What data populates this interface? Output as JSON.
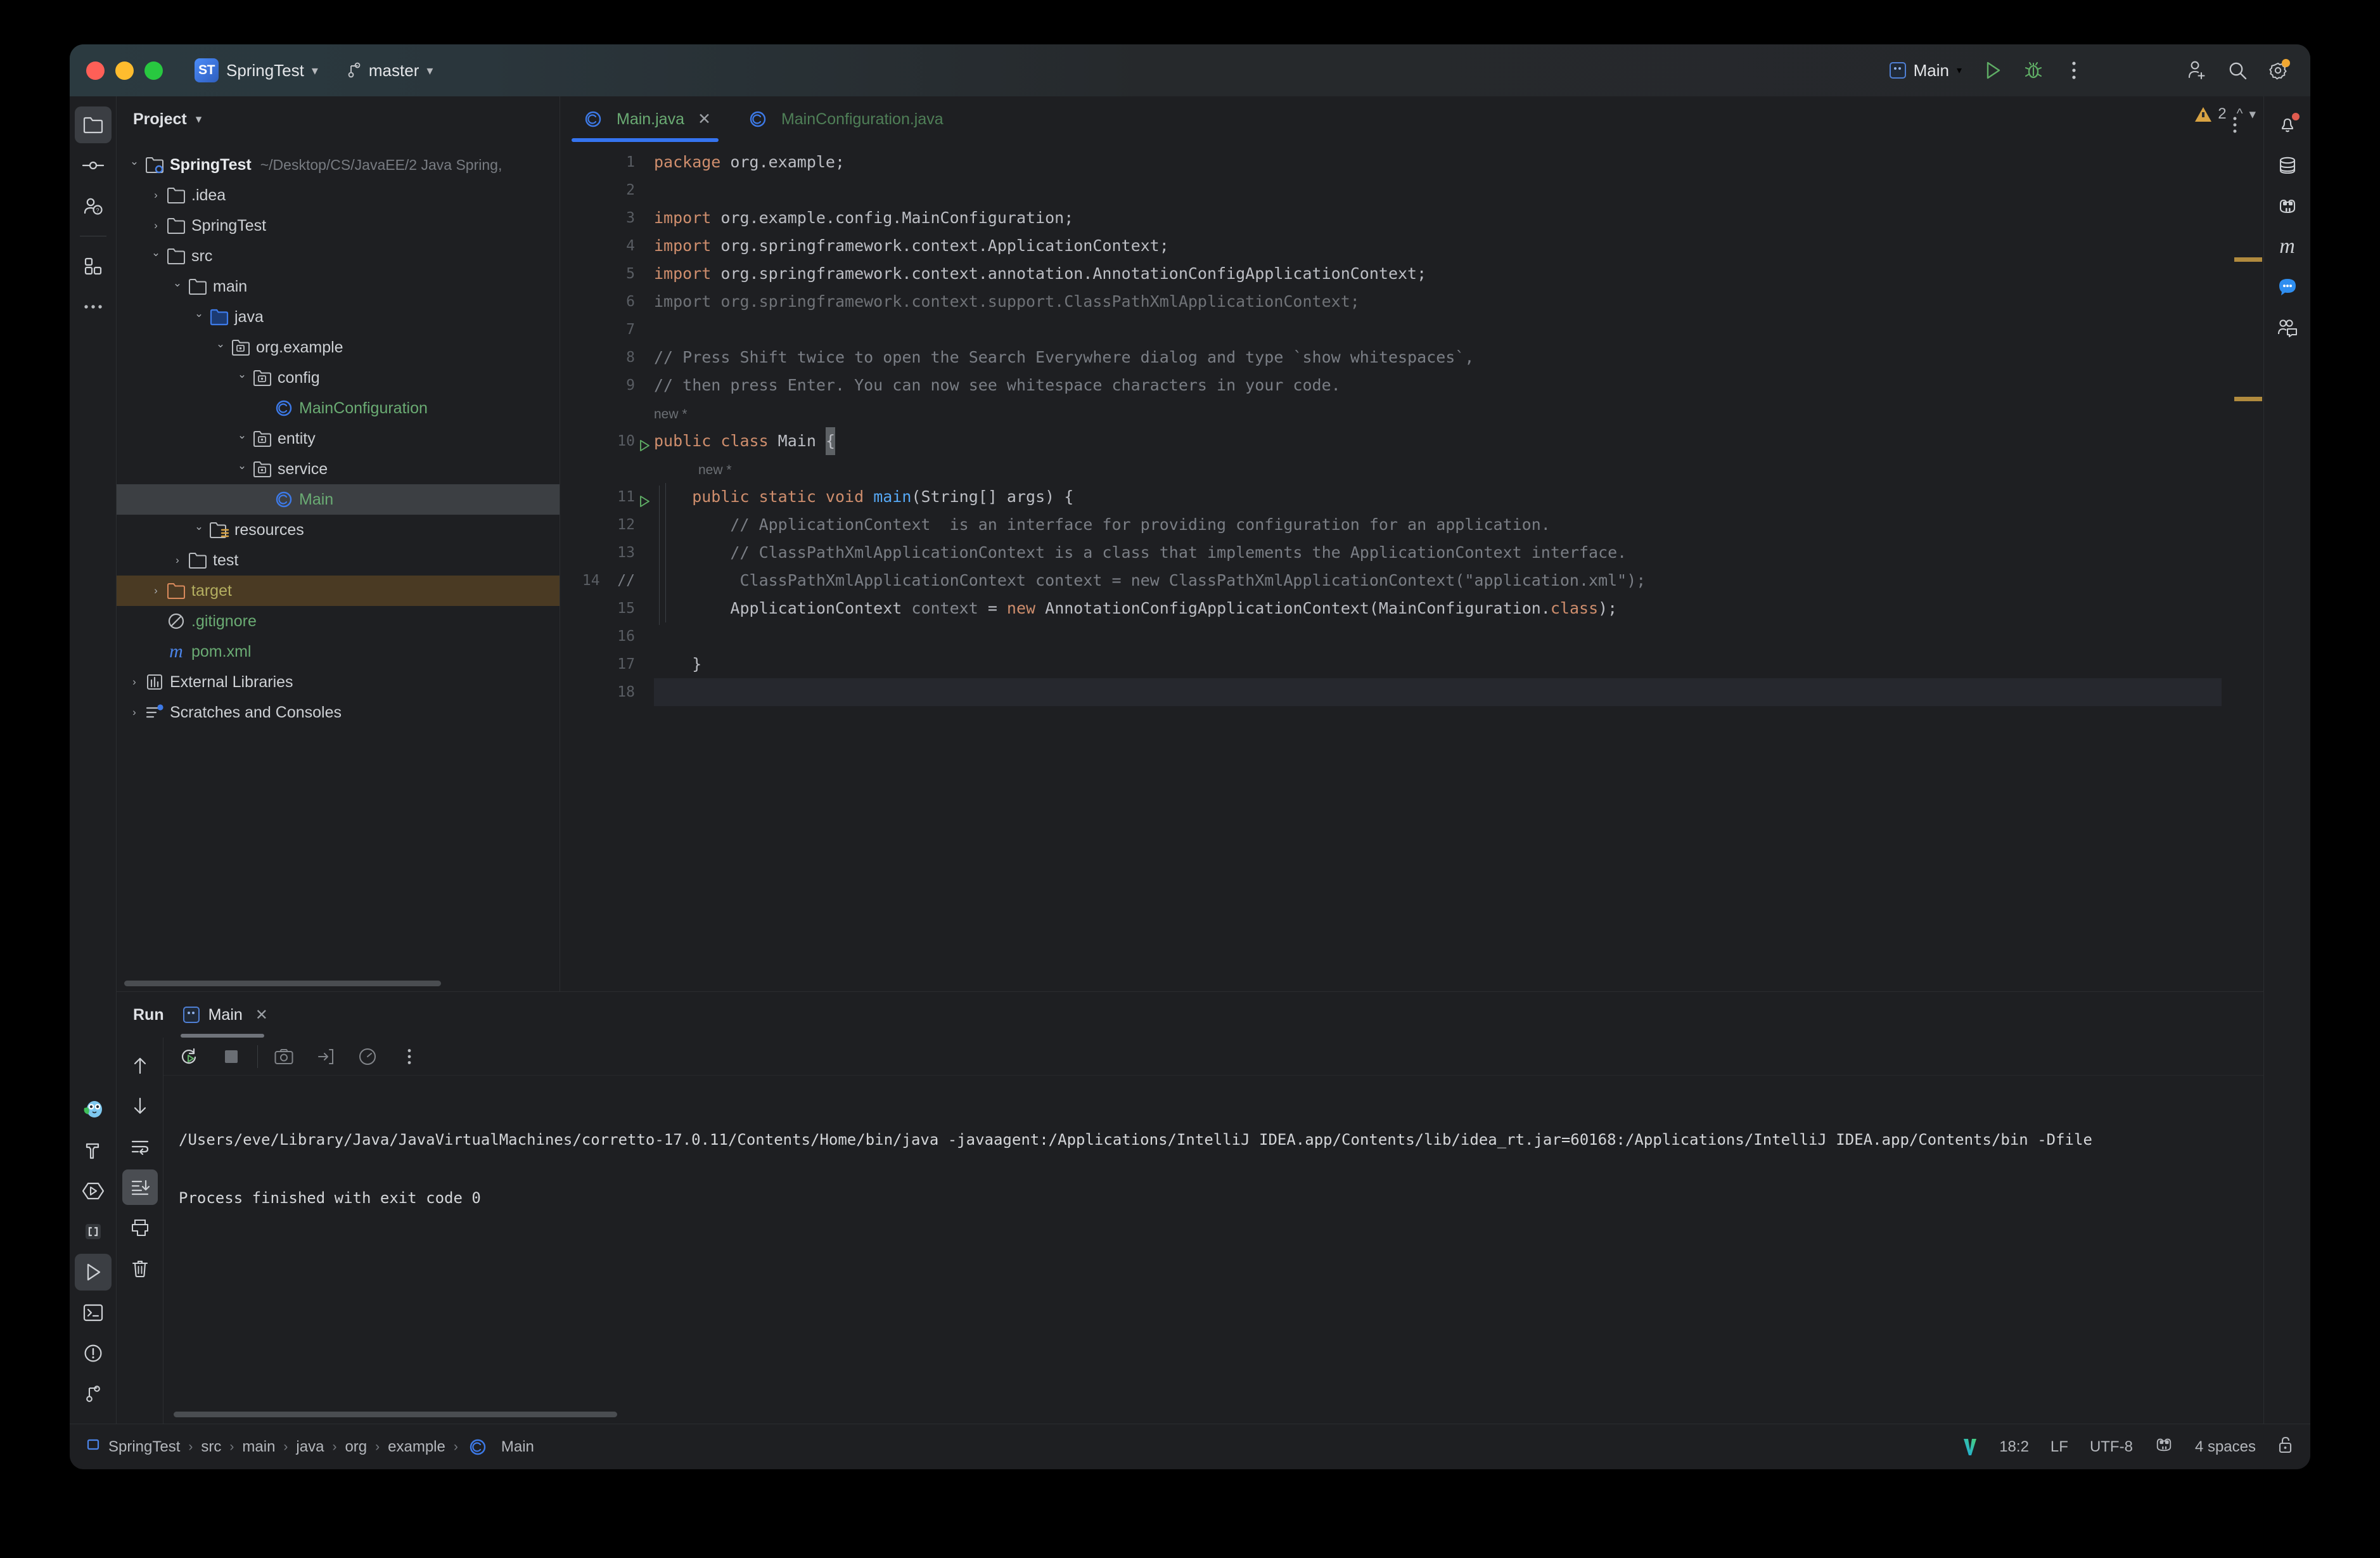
{
  "window": {
    "titlebar": {
      "project_badge": "ST",
      "project_name": "SpringTest",
      "branch": "master",
      "run_config": "Main",
      "icons": [
        "run-icon",
        "debug-icon",
        "more-options-icon",
        "add-user-icon",
        "search-icon",
        "settings-icon"
      ]
    }
  },
  "left_strip": {
    "items": [
      {
        "name": "project-tool-window",
        "icon": "folder-icon",
        "selected": true
      },
      {
        "name": "commit-tool-window",
        "icon": "commit-icon",
        "selected": false
      },
      {
        "name": "pull-requests-tool-window",
        "icon": "user-question-icon",
        "selected": false
      },
      {
        "name": "structure-tool-window",
        "icon": "structure-icon",
        "selected": false
      },
      {
        "name": "more-tool-windows",
        "icon": "ellipsis-icon",
        "selected": false
      }
    ],
    "bottom_items": [
      {
        "name": "plugin-tool-window",
        "icon": "owl-icon",
        "selected": false
      },
      {
        "name": "build-tool-window",
        "icon": "hammer-icon",
        "selected": false
      },
      {
        "name": "run-anything",
        "icon": "run-hex-icon",
        "selected": false
      },
      {
        "name": "brackets-tool-window",
        "icon": "brackets-icon",
        "selected": false
      },
      {
        "name": "run-tool-window",
        "icon": "play-icon",
        "selected": true
      },
      {
        "name": "terminal-tool-window",
        "icon": "terminal-icon",
        "selected": false
      },
      {
        "name": "problems-tool-window",
        "icon": "warning-circle-icon",
        "selected": false
      },
      {
        "name": "git-tool-window",
        "icon": "branch-icon",
        "selected": false
      }
    ]
  },
  "right_strip": {
    "items": [
      {
        "name": "notifications",
        "icon": "bell-icon",
        "badge": true
      },
      {
        "name": "database",
        "icon": "database-icon",
        "badge": false
      },
      {
        "name": "endpoints",
        "icon": "gradle-icon",
        "badge": false
      },
      {
        "name": "maven",
        "icon": "maven-m-icon",
        "badge": false
      },
      {
        "name": "ai-assistant",
        "icon": "ai-chat-icon",
        "badge": false
      },
      {
        "name": "code-with-me",
        "icon": "code-with-me-icon",
        "badge": false
      }
    ]
  },
  "project_panel": {
    "title": "Project",
    "tree": [
      {
        "label": "SpringTest",
        "path": "~/Desktop/CS/JavaEE/2 Java Spring,",
        "indent": 0,
        "arrow": "down",
        "icon": "module-icon",
        "style": "bold"
      },
      {
        "label": ".idea",
        "indent": 1,
        "arrow": "right",
        "icon": "folder-icon",
        "style": "normal"
      },
      {
        "label": "SpringTest",
        "indent": 1,
        "arrow": "right",
        "icon": "folder-icon",
        "style": "normal"
      },
      {
        "label": "src",
        "indent": 1,
        "arrow": "down",
        "icon": "folder-icon",
        "style": "normal"
      },
      {
        "label": "main",
        "indent": 2,
        "arrow": "down",
        "icon": "folder-icon",
        "style": "normal"
      },
      {
        "label": "java",
        "indent": 3,
        "arrow": "down",
        "icon": "source-folder-icon",
        "style": "normal"
      },
      {
        "label": "org.example",
        "indent": 4,
        "arrow": "down",
        "icon": "package-icon",
        "style": "normal"
      },
      {
        "label": "config",
        "indent": 5,
        "arrow": "down",
        "icon": "package-icon",
        "style": "normal"
      },
      {
        "label": "MainConfiguration",
        "indent": 6,
        "arrow": "none",
        "icon": "class-icon",
        "style": "green"
      },
      {
        "label": "entity",
        "indent": 5,
        "arrow": "down",
        "icon": "package-icon",
        "style": "normal"
      },
      {
        "label": "service",
        "indent": 5,
        "arrow": "down",
        "icon": "package-icon",
        "style": "normal"
      },
      {
        "label": "Main",
        "indent": 6,
        "arrow": "none",
        "icon": "class-icon",
        "style": "green",
        "selected": true
      },
      {
        "label": "resources",
        "indent": 3,
        "arrow": "down",
        "icon": "resources-folder-icon",
        "style": "normal"
      },
      {
        "label": "test",
        "indent": 2,
        "arrow": "right",
        "icon": "folder-icon",
        "style": "normal"
      },
      {
        "label": "target",
        "indent": 1,
        "arrow": "right",
        "icon": "excluded-folder-icon",
        "style": "yellow",
        "highlighted": true
      },
      {
        "label": ".gitignore",
        "indent": 1,
        "arrow": "none",
        "icon": "gitignore-icon",
        "style": "green"
      },
      {
        "label": "pom.xml",
        "indent": 1,
        "arrow": "none",
        "icon": "maven-m-icon",
        "style": "green"
      },
      {
        "label": "External Libraries",
        "indent": 0,
        "arrow": "right",
        "icon": "libraries-icon",
        "style": "normal"
      },
      {
        "label": "Scratches and Consoles",
        "indent": 0,
        "arrow": "right",
        "icon": "scratches-icon",
        "style": "normal"
      }
    ]
  },
  "editor": {
    "tabs": [
      {
        "label": "Main.java",
        "icon": "class-icon",
        "active": true,
        "closable": true
      },
      {
        "label": "MainConfiguration.java",
        "icon": "class-icon",
        "active": false,
        "closable": false
      }
    ],
    "inspection": {
      "warning_count": "2",
      "icon": "warning-triangle-icon"
    },
    "more_icon": "more-vertical-icon",
    "lines": [
      {
        "n": "1",
        "runnable": false,
        "tokens": [
          {
            "t": "package ",
            "c": "kw"
          },
          {
            "t": "org.example;",
            "c": ""
          }
        ]
      },
      {
        "n": "2",
        "runnable": false,
        "tokens": []
      },
      {
        "n": "3",
        "runnable": false,
        "tokens": [
          {
            "t": "import ",
            "c": "kw"
          },
          {
            "t": "org.example.config.MainConfiguration;",
            "c": ""
          }
        ]
      },
      {
        "n": "4",
        "runnable": false,
        "tokens": [
          {
            "t": "import ",
            "c": "kw"
          },
          {
            "t": "org.springframework.context.ApplicationContext;",
            "c": ""
          }
        ]
      },
      {
        "n": "5",
        "runnable": false,
        "tokens": [
          {
            "t": "import ",
            "c": "kw"
          },
          {
            "t": "org.springframework.context.annotation.AnnotationConfigApplicationContext;",
            "c": ""
          }
        ]
      },
      {
        "n": "6",
        "runnable": false,
        "tokens": [
          {
            "t": "import org.springframework.context.support.ClassPathXmlApplicationContext;",
            "c": "dim"
          }
        ]
      },
      {
        "n": "7",
        "runnable": false,
        "tokens": []
      },
      {
        "n": "8",
        "runnable": false,
        "tokens": [
          {
            "t": "// Press Shift twice to open the Search Everywhere dialog and type `show whitespaces`,",
            "c": "cmt"
          }
        ]
      },
      {
        "n": "9",
        "runnable": false,
        "tokens": [
          {
            "t": "// then press Enter. You can now see whitespace characters in your code.",
            "c": "cmt"
          }
        ]
      },
      {
        "n": "",
        "runnable": false,
        "inlay": "new *",
        "inlay_indent": 0
      },
      {
        "n": "10",
        "runnable": true,
        "tokens": [
          {
            "t": "public class ",
            "c": "kw"
          },
          {
            "t": "Main ",
            "c": ""
          },
          {
            "t": "{",
            "c": "caret"
          }
        ]
      },
      {
        "n": "",
        "runnable": false,
        "inlay": "new *",
        "inlay_indent": 1
      },
      {
        "n": "11",
        "runnable": true,
        "tokens": [
          {
            "t": "    public static void ",
            "c": "kw"
          },
          {
            "t": "main",
            "c": "fn"
          },
          {
            "t": "(String[] args) {",
            "c": ""
          }
        ]
      },
      {
        "n": "12",
        "runnable": false,
        "tokens": [
          {
            "t": "        // ApplicationContext  is an interface for providing configuration for an application.",
            "c": "cmt"
          }
        ]
      },
      {
        "n": "13",
        "runnable": false,
        "tokens": [
          {
            "t": "        // ClassPathXmlApplicationContext is a class that implements the ApplicationContext interface.",
            "c": "cmt"
          }
        ]
      },
      {
        "n": "14",
        "runnable": false,
        "commented_gutter": "//",
        "tokens": [
          {
            "t": "         ClassPathXmlApplicationContext context = new ClassPathXmlApplicationContext(\"application.xml\");",
            "c": "cmt"
          }
        ]
      },
      {
        "n": "15",
        "runnable": false,
        "tokens": [
          {
            "t": "        ApplicationContext ",
            "c": ""
          },
          {
            "t": "context ",
            "c": "param"
          },
          {
            "t": "= ",
            "c": ""
          },
          {
            "t": "new ",
            "c": "kw"
          },
          {
            "t": "AnnotationConfigApplicationContext(MainConfiguration.",
            "c": ""
          },
          {
            "t": "class",
            "c": "kw"
          },
          {
            "t": ");",
            "c": ""
          }
        ]
      },
      {
        "n": "16",
        "runnable": false,
        "tokens": []
      },
      {
        "n": "17",
        "runnable": false,
        "tokens": [
          {
            "t": "    }",
            "c": ""
          }
        ]
      },
      {
        "n": "18",
        "runnable": false,
        "current": true,
        "tokens": [
          {
            "t": "}",
            "c": "caret"
          }
        ]
      }
    ]
  },
  "run_panel": {
    "title": "Run",
    "tab": {
      "label": "Main",
      "icon": "run-config-icon",
      "close_icon": "close-icon"
    },
    "toolbar_top": [
      {
        "name": "rerun-button",
        "icon": "rerun-icon"
      },
      {
        "name": "stop-button",
        "icon": "stop-icon"
      },
      {
        "name": "screenshot-button",
        "icon": "camera-icon"
      },
      {
        "name": "export-button",
        "icon": "export-icon"
      },
      {
        "name": "profiler-button",
        "icon": "gauge-icon"
      },
      {
        "name": "more-run-options",
        "icon": "more-vertical-icon"
      }
    ],
    "toolbar_side": [
      {
        "name": "up-button",
        "icon": "arrow-up-icon",
        "selected": false
      },
      {
        "name": "down-button",
        "icon": "arrow-down-icon",
        "selected": false
      },
      {
        "name": "soft-wrap-button",
        "icon": "soft-wrap-icon",
        "selected": false
      },
      {
        "name": "scroll-to-end-button",
        "icon": "scroll-to-end-icon",
        "selected": true
      },
      {
        "name": "print-button",
        "icon": "print-icon",
        "selected": false
      },
      {
        "name": "clear-all-button",
        "icon": "trash-icon",
        "selected": false
      }
    ],
    "console": [
      "/Users/eve/Library/Java/JavaVirtualMachines/corretto-17.0.11/Contents/Home/bin/java -javaagent:/Applications/IntelliJ IDEA.app/Contents/lib/idea_rt.jar=60168:/Applications/IntelliJ IDEA.app/Contents/bin -Dfile",
      "",
      "Process finished with exit code 0"
    ]
  },
  "status_bar": {
    "breadcrumbs": [
      "SpringTest",
      "src",
      "main",
      "java",
      "org",
      "example",
      "Main"
    ],
    "breadcrumb_sep": "›",
    "right": {
      "vcs_icon": "vim-icon",
      "caret_position": "18:2",
      "line_separator": "LF",
      "encoding": "UTF-8",
      "branch_icon": "gradle-icon",
      "indent": "4 spaces",
      "lock_icon": "unlock-icon"
    }
  }
}
